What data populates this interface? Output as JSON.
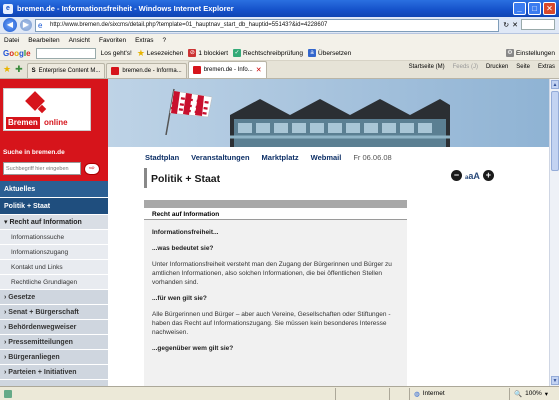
{
  "window": {
    "title": "bremen.de - Informationsfreiheit - Windows Internet Explorer",
    "minimize": "_",
    "maximize": "□",
    "close": "✕"
  },
  "address": {
    "url": "http://www.bremen.de/sixcms/detail.php?template=01_hauptnav_start_db_hauptid=55143?&id=4228607",
    "refresh": "↻",
    "stop": "✕"
  },
  "menu": [
    "Datei",
    "Bearbeiten",
    "Ansicht",
    "Favoriten",
    "Extras",
    "?"
  ],
  "googlebar": {
    "logo": [
      "G",
      "o",
      "o",
      "g",
      "l",
      "e"
    ],
    "search_btn": "Los geht's!",
    "bookmarks": "Lesezeichen",
    "blocked": "1 blockiert",
    "spellcheck": "Rechtschreibprüfung",
    "translate": "Übersetzen",
    "settings": "Einstellungen"
  },
  "tabs": [
    {
      "label": "Enterprise Content M..."
    },
    {
      "label": "bremen.de - Informa..."
    },
    {
      "label": "bremen.de - Info...",
      "active": true
    }
  ],
  "tab_tools": [
    "Startseite (M)",
    "Feeds (J)",
    "Drucken",
    "Seite",
    "Extras"
  ],
  "site": {
    "logo_bremen": "Bremen",
    "logo_online": "online",
    "nav": [
      "Stadtplan",
      "Veranstaltungen",
      "Marktplatz",
      "Webmail"
    ],
    "date": "Fr 06.06.08",
    "search_heading": "Suche in bremen.de",
    "search_placeholder": "Suchbegriff hier eingeben",
    "search_go": "⇨"
  },
  "sidebar": {
    "main": [
      "Aktuelles",
      "Politik + Staat"
    ],
    "section": "Recht auf Information",
    "sub": [
      "Informationssuche",
      "Informationszugang",
      "Kontakt und Links",
      "Rechtliche Grundlagen"
    ],
    "categories": [
      "Gesetze",
      "Senat + Bürgerschaft",
      "Behördenwegweiser",
      "Pressemitteilungen",
      "Bürgeranliegen",
      "Parteien + Initiativen"
    ]
  },
  "content": {
    "title": "Politik + Staat",
    "fontsize": {
      "minus": "−",
      "aa_small": "a",
      "aa_big": "aA",
      "plus": "+"
    },
    "article_header": "Recht auf Information",
    "paragraphs": [
      {
        "text": "Informationsfreiheit...",
        "bold": true
      },
      {
        "text": "...was bedeutet sie?",
        "bold": true
      },
      {
        "text": "Unter Informationsfreiheit versteht man den Zugang der Bürgerinnen und Bürger zu amtlichen Informationen, also solchen Informationen, die bei öffentlichen Stellen vorhanden sind.",
        "bold": false
      },
      {
        "text": "...für wen gilt sie?",
        "bold": true
      },
      {
        "text": "Alle Bürgerinnen und Bürger – aber auch Vereine, Gesellschaften oder Stiftungen - haben das Recht auf Informationszugang. Sie müssen kein besonderes Interesse nachweisen.",
        "bold": false
      },
      {
        "text": "...gegenüber wem gilt sie?",
        "bold": true
      }
    ]
  },
  "statusbar": {
    "zone": "Internet",
    "zoom": "100%"
  },
  "colors": {
    "brand_red": "#d6141b",
    "nav_blue": "#2b5f93"
  }
}
